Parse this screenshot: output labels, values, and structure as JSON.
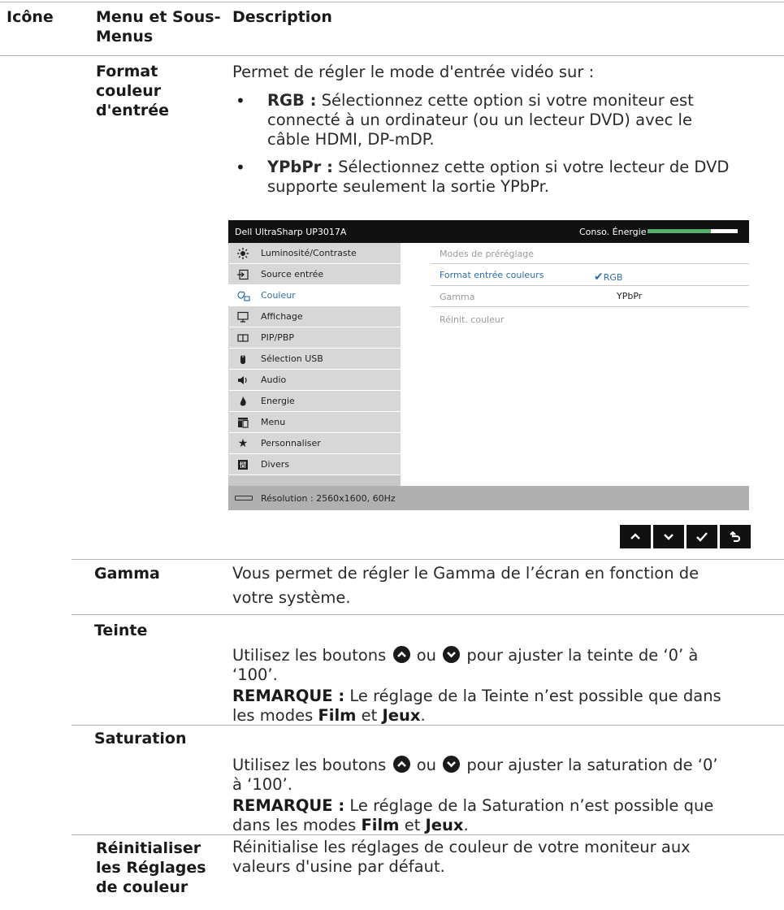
{
  "header": {
    "col1": "Icône",
    "col2_line1": "Menu et Sous-",
    "col2_line2": "Menus",
    "col3": "Description"
  },
  "row_format": {
    "title_lines": [
      "Format",
      "couleur",
      "d'entrée"
    ],
    "intro": "Permet de régler le mode d'entrée vidéo sur :",
    "bullets": [
      {
        "term": "RGB :",
        "text_lines": [
          " Sélectionnez cette option si votre moniteur est",
          "connecté à un ordinateur (ou un lecteur DVD) avec le",
          "câble HDMI, DP-mDP."
        ]
      },
      {
        "term": "YPbPr :",
        "text_lines": [
          " Sélectionnez cette option si votre lecteur de DVD",
          "supporte seulement la sortie YPbPr."
        ]
      }
    ]
  },
  "osd": {
    "title": "Dell UltraSharp UP3017A",
    "energy_label": "Conso. Énergie",
    "energy_level": 0.7,
    "menu_items": [
      {
        "label": "Luminosité/Contraste",
        "icon": "sun-icon"
      },
      {
        "label": "Source entrée",
        "icon": "input-source-icon"
      },
      {
        "label": "Couleur",
        "icon": "color-icon"
      },
      {
        "label": "Affichage",
        "icon": "display-icon"
      },
      {
        "label": "PIP/PBP",
        "icon": "pip-icon"
      },
      {
        "label": "Sélection USB",
        "icon": "usb-icon"
      },
      {
        "label": "Audio",
        "icon": "speaker-icon"
      },
      {
        "label": "Energie",
        "icon": "power-icon"
      },
      {
        "label": "Menu",
        "icon": "menu-icon"
      },
      {
        "label": "Personnaliser",
        "icon": "star-icon"
      },
      {
        "label": "Divers",
        "icon": "misc-icon"
      }
    ],
    "submenu": [
      "Modes de préréglage",
      "Format entrée couleurs",
      "Gamma",
      "Réinit. couleur"
    ],
    "options": [
      "RGB",
      "YPbPr"
    ],
    "footer": "Résolution : 2560x1600, 60Hz",
    "colors": {
      "accent": "#2e6fa7",
      "energy": "#55b06b"
    }
  },
  "row_gamma": {
    "title": "Gamma",
    "line1": "Vous permet de régler le Gamma de l’écran en fonction de",
    "line2": "votre système."
  },
  "row_teinte": {
    "title": "Teinte",
    "line1_a": "Utilisez les boutons ",
    "line1_or": " ou ",
    "line1_b": " pour ajuster la teinte de ‘0’ à",
    "line2": "‘100’.",
    "note_label": "REMARQUE :",
    "note_text": " Le réglage de la Teinte n’est possible que dans",
    "note_line2_a": "les modes ",
    "mode1": "Film",
    "and": " et ",
    "mode2": "Jeux",
    "period": "."
  },
  "row_saturation": {
    "title": "Saturation",
    "line1_a": "Utilisez les boutons ",
    "line1_or": " ou ",
    "line1_b": " pour ajuster la saturation de ‘0’",
    "line2": "à ‘100’.",
    "note_label": "REMARQUE :",
    "note_text_a": " Le réglage de la ",
    "note_term": "Saturation",
    "note_text_b": " n’est possible que",
    "note_line2_a": "dans les modes ",
    "mode1": "Film",
    "and": " et ",
    "mode2": "Jeux",
    "period": "."
  },
  "row_reset": {
    "title_lines": [
      "Réinitialiser",
      "les Réglages",
      "de couleur"
    ],
    "line1": "Réinitialise les réglages de couleur de votre moniteur aux",
    "line2": "valeurs d'usine par défaut."
  }
}
